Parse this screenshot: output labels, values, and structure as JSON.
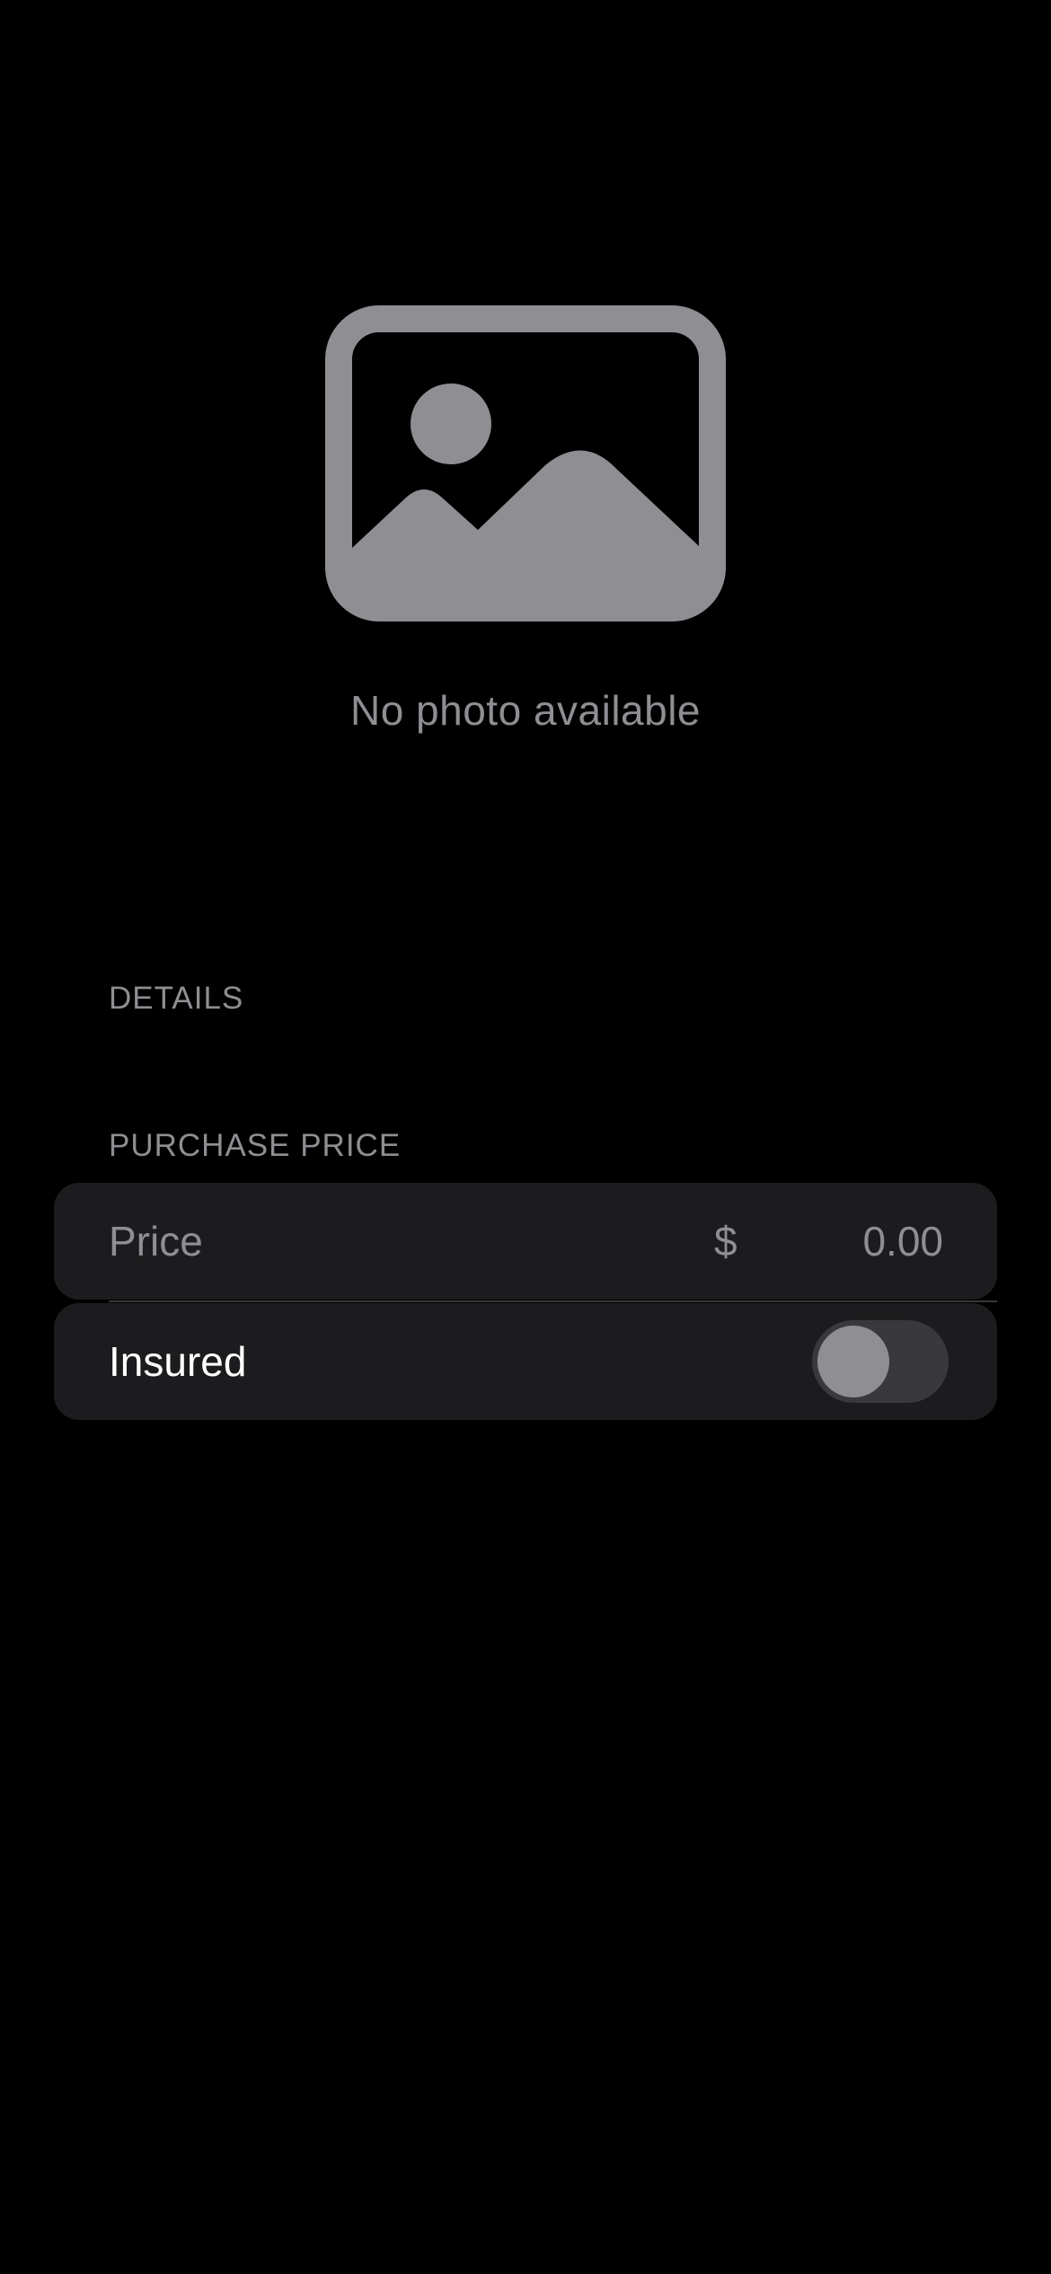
{
  "photo": {
    "icon": "photo-placeholder-icon",
    "caption": "No photo available"
  },
  "sections": {
    "details": {
      "header": "DETAILS"
    },
    "purchase_price": {
      "header": "PURCHASE PRICE",
      "price": {
        "label": "Price",
        "currency_symbol": "$",
        "value": "",
        "placeholder": "0.00"
      },
      "insured": {
        "label": "Insured",
        "is_on": false
      }
    }
  },
  "colors": {
    "background": "#000000",
    "cell_background": "#1c1c1e",
    "secondary_text": "#8e8e93",
    "primary_text": "#ffffff",
    "toggle_off_track": "#39393d"
  }
}
